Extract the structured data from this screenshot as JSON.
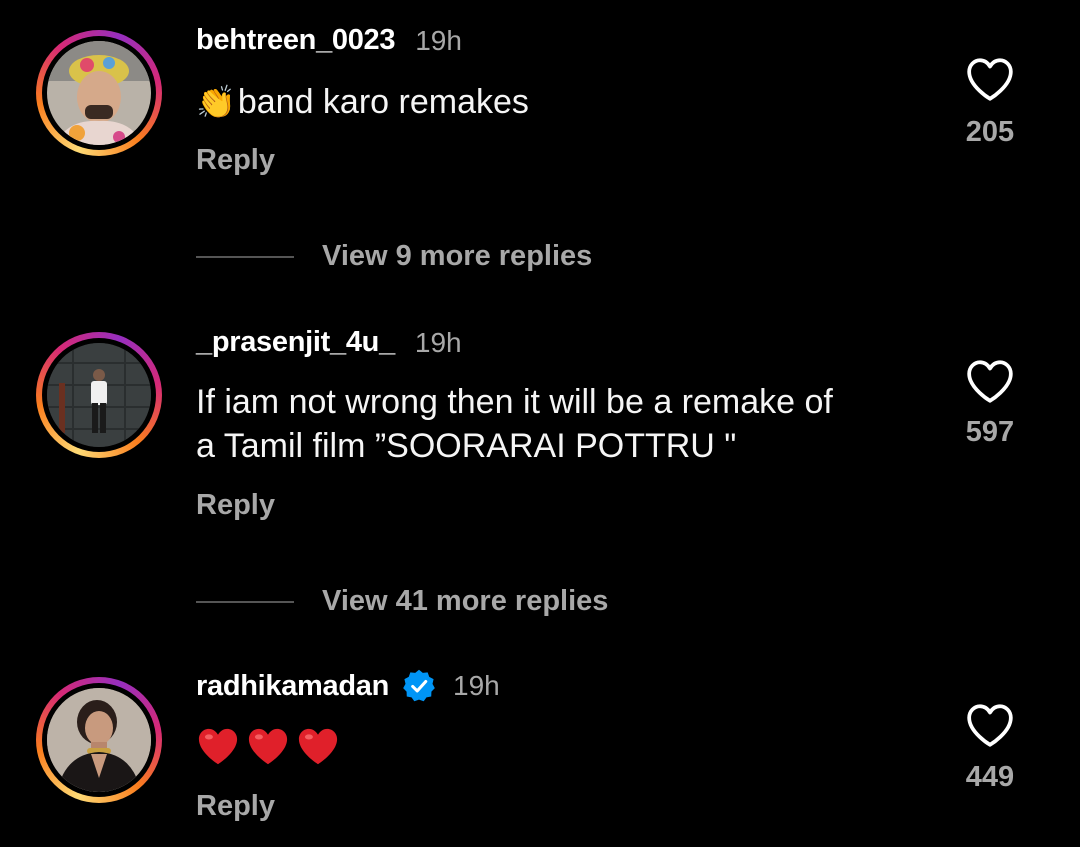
{
  "comments": [
    {
      "username": "behtreen_0023",
      "time": "19h",
      "text": "band karo remakes",
      "emoji_prefix": "👏",
      "reply_label": "Reply",
      "likes": "205",
      "view_replies": "View 9 more replies",
      "verified": false
    },
    {
      "username": "_prasenjit_4u_",
      "time": "19h",
      "text_line1": "If iam not wrong then it will be a remake of",
      "text_line2": "a Tamil film ”SOORARAI POTTRU \"",
      "reply_label": "Reply",
      "likes": "597",
      "view_replies": "View 41 more replies",
      "verified": false
    },
    {
      "username": "radhikamadan",
      "time": "19h",
      "text": "❤️❤️❤️",
      "reply_label": "Reply",
      "likes": "449",
      "verified": true
    }
  ],
  "icons": {
    "like": "heart-outline-icon",
    "verified": "verified-badge-icon"
  },
  "colors": {
    "background": "#000000",
    "text_primary": "#ffffff",
    "text_secondary": "#a8a8a8",
    "verified_blue": "#0095f6",
    "heart_red": "#e0202a"
  }
}
